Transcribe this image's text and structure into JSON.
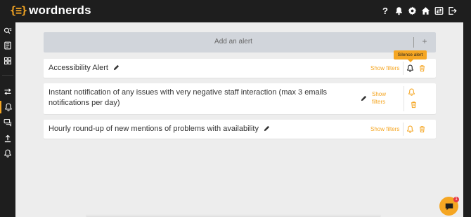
{
  "brand": {
    "mark": "{≡}",
    "name": "wordnerds",
    "accent": "#f5a623"
  },
  "topbar": {
    "icons": [
      "help-icon",
      "bell-icon",
      "gear-icon",
      "home-icon",
      "switch-icon",
      "logout-icon"
    ],
    "help_label": "?"
  },
  "sidebar": {
    "items": [
      "search-filter-icon",
      "document-icon",
      "grid-icon",
      "arrows-icon",
      "bell-icon",
      "chat-icon",
      "upload-icon",
      "bell-icon"
    ],
    "active": "bell-icon"
  },
  "add_alert": {
    "label": "Add an alert",
    "plus": "+"
  },
  "tooltip": {
    "text": "Silence alert"
  },
  "alerts": [
    {
      "title": "Accessibility Alert",
      "show_filters": "Show filters"
    },
    {
      "title": "Instant notification of any issues with very negative staff interaction (max 3 emails notifications per day)",
      "show_filters": "Show filters"
    },
    {
      "title": "Hourly round-up of new mentions of problems with availability",
      "show_filters": "Show filters"
    }
  ],
  "chat": {
    "badge": "1"
  }
}
